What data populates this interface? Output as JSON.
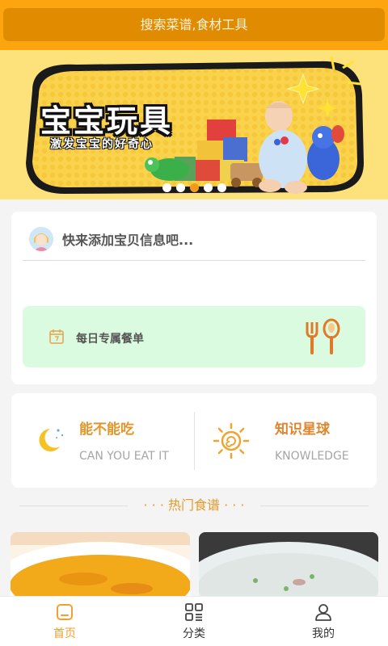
{
  "search": {
    "placeholder": "搜索菜谱,食材工具"
  },
  "banner": {
    "title": "宝宝玩具",
    "subtitle": "激发宝宝的好奇心",
    "slide_count": 5,
    "active_slide": 2
  },
  "baby_card": {
    "prompt": "快来添加宝贝信息吧...",
    "daily_menu_label": "每日专属餐单"
  },
  "features": [
    {
      "title": "能不能吃",
      "subtitle": "CAN YOU EAT IT",
      "color": "#e2962a",
      "icon": "moon-icon"
    },
    {
      "title": "知识星球",
      "subtitle": "KNOWLEDGE",
      "color": "#e0852c",
      "icon": "sun-icon"
    }
  ],
  "section": {
    "title": "· · · 热门食谱 · · ·"
  },
  "tabs": [
    {
      "label": "首页",
      "icon": "home-icon",
      "active": true
    },
    {
      "label": "分类",
      "icon": "category-icon",
      "active": false
    },
    {
      "label": "我的",
      "icon": "user-icon",
      "active": false
    }
  ],
  "colors": {
    "accent": "#fda50f",
    "active_tab": "#f1a02c",
    "meal_box": "#dbfbe1"
  }
}
